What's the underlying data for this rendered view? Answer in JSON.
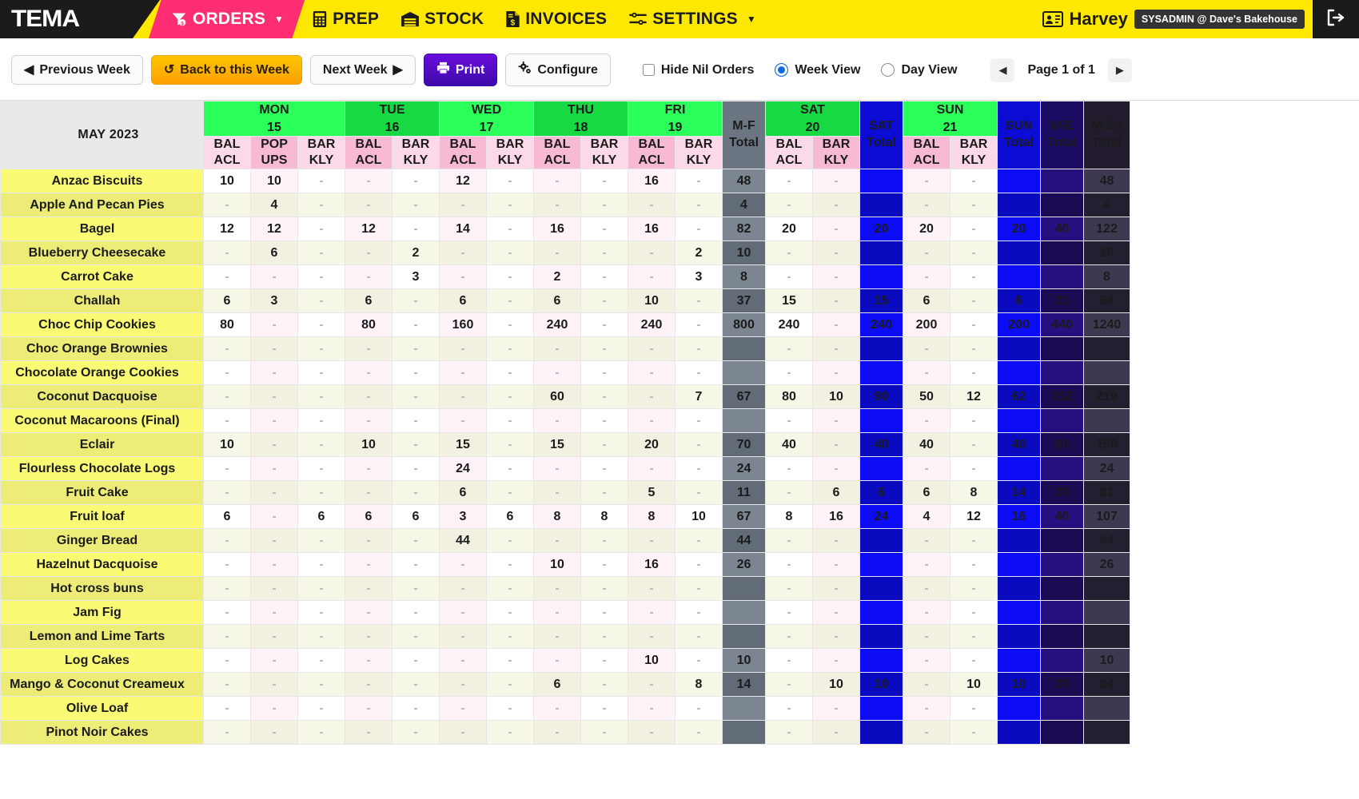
{
  "nav": {
    "logo": "TEMA",
    "items": [
      {
        "label": "ORDERS",
        "icon": "funnel-dollar-icon",
        "active": true,
        "caret": true
      },
      {
        "label": "PREP",
        "icon": "calculator-icon",
        "active": false,
        "caret": false
      },
      {
        "label": "STOCK",
        "icon": "warehouse-icon",
        "active": false,
        "caret": false
      },
      {
        "label": "INVOICES",
        "icon": "invoice-dollar-icon",
        "active": false,
        "caret": false
      },
      {
        "label": "SETTINGS",
        "icon": "sliders-icon",
        "active": false,
        "caret": true
      }
    ],
    "user_name": "Harvey",
    "user_badge": "SYSADMIN @ Dave's Bakehouse",
    "logout_icon": "logout-icon"
  },
  "toolbar": {
    "previous_week": "Previous Week",
    "back_to_this_week": "Back to this Week",
    "next_week": "Next Week",
    "print": "Print",
    "configure": "Configure",
    "hide_nil_orders": "Hide Nil Orders",
    "hide_nil_checked": false,
    "week_view": "Week View",
    "day_view": "Day View",
    "view_mode": "Week View",
    "page_label": "Page 1 of 1",
    "accent_print": "#4d0bc8",
    "accent_back": "#ffa000",
    "accent_radio": "#0a6ae1"
  },
  "grid": {
    "month_label": "MAY 2023",
    "days": [
      {
        "name": "MON",
        "num": "15",
        "shade": "a",
        "cols": [
          {
            "l1": "BAL",
            "l2": "ACL",
            "shade": "a"
          },
          {
            "l1": "POP",
            "l2": "UPS",
            "shade": "b"
          },
          {
            "l1": "BAR",
            "l2": "KLY",
            "shade": "a"
          }
        ]
      },
      {
        "name": "TUE",
        "num": "16",
        "shade": "b",
        "cols": [
          {
            "l1": "BAL",
            "l2": "ACL",
            "shade": "b"
          },
          {
            "l1": "BAR",
            "l2": "KLY",
            "shade": "a"
          }
        ]
      },
      {
        "name": "WED",
        "num": "17",
        "shade": "a",
        "cols": [
          {
            "l1": "BAL",
            "l2": "ACL",
            "shade": "b"
          },
          {
            "l1": "BAR",
            "l2": "KLY",
            "shade": "a"
          }
        ]
      },
      {
        "name": "THU",
        "num": "18",
        "shade": "b",
        "cols": [
          {
            "l1": "BAL",
            "l2": "ACL",
            "shade": "b"
          },
          {
            "l1": "BAR",
            "l2": "KLY",
            "shade": "a"
          }
        ]
      },
      {
        "name": "FRI",
        "num": "19",
        "shade": "a",
        "cols": [
          {
            "l1": "BAL",
            "l2": "ACL",
            "shade": "b"
          },
          {
            "l1": "BAR",
            "l2": "KLY",
            "shade": "a"
          }
        ]
      }
    ],
    "mf_total": {
      "l1": "M-F",
      "l2": "Total"
    },
    "sat": {
      "name": "SAT",
      "num": "20",
      "shade": "b",
      "cols": [
        {
          "l1": "BAL",
          "l2": "ACL",
          "shade": "a"
        },
        {
          "l1": "BAR",
          "l2": "KLY",
          "shade": "b"
        }
      ]
    },
    "sat_total": {
      "l1": "SAT",
      "l2": "Total"
    },
    "sun": {
      "name": "SUN",
      "num": "21",
      "shade": "a",
      "cols": [
        {
          "l1": "BAL",
          "l2": "ACL",
          "shade": "b"
        },
        {
          "l1": "BAR",
          "l2": "KLY",
          "shade": "a"
        }
      ]
    },
    "sun_total": {
      "l1": "SUN",
      "l2": "Total"
    },
    "we_total": {
      "l1": "W/E",
      "l2": "Total"
    },
    "msn_total": {
      "l1": "M-Sn",
      "l2": "Total"
    },
    "nil_symbol": "-",
    "rows": [
      {
        "name": "Anzac Biscuits",
        "v": [
          "10",
          "10",
          "-",
          "-",
          "-",
          "12",
          "-",
          "-",
          "-",
          "16",
          "-"
        ],
        "mf": "48",
        "sat": [
          "-",
          "-"
        ],
        "sattot": "",
        "sun": [
          "-",
          "-"
        ],
        "suntot": "",
        "we": "",
        "msn": "48"
      },
      {
        "name": "Apple And Pecan Pies",
        "v": [
          "-",
          "4",
          "-",
          "-",
          "-",
          "-",
          "-",
          "-",
          "-",
          "-",
          "-"
        ],
        "mf": "4",
        "sat": [
          "-",
          "-"
        ],
        "sattot": "",
        "sun": [
          "-",
          "-"
        ],
        "suntot": "",
        "we": "",
        "msn": "4"
      },
      {
        "name": "Bagel",
        "v": [
          "12",
          "12",
          "-",
          "12",
          "-",
          "14",
          "-",
          "16",
          "-",
          "16",
          "-"
        ],
        "mf": "82",
        "sat": [
          "20",
          "-"
        ],
        "sattot": "20",
        "sun": [
          "20",
          "-"
        ],
        "suntot": "20",
        "we": "40",
        "msn": "122"
      },
      {
        "name": "Blueberry Cheesecake",
        "v": [
          "-",
          "6",
          "-",
          "-",
          "2",
          "-",
          "-",
          "-",
          "-",
          "-",
          "2"
        ],
        "mf": "10",
        "sat": [
          "-",
          "-"
        ],
        "sattot": "",
        "sun": [
          "-",
          "-"
        ],
        "suntot": "",
        "we": "",
        "msn": "10"
      },
      {
        "name": "Carrot Cake",
        "v": [
          "-",
          "-",
          "-",
          "-",
          "3",
          "-",
          "-",
          "2",
          "-",
          "-",
          "3"
        ],
        "mf": "8",
        "sat": [
          "-",
          "-"
        ],
        "sattot": "",
        "sun": [
          "-",
          "-"
        ],
        "suntot": "",
        "we": "",
        "msn": "8"
      },
      {
        "name": "Challah",
        "v": [
          "6",
          "3",
          "-",
          "6",
          "-",
          "6",
          "-",
          "6",
          "-",
          "10",
          "-"
        ],
        "mf": "37",
        "sat": [
          "15",
          "-"
        ],
        "sattot": "15",
        "sun": [
          "6",
          "-"
        ],
        "suntot": "6",
        "we": "21",
        "msn": "58"
      },
      {
        "name": "Choc Chip Cookies",
        "v": [
          "80",
          "-",
          "-",
          "80",
          "-",
          "160",
          "-",
          "240",
          "-",
          "240",
          "-"
        ],
        "mf": "800",
        "sat": [
          "240",
          "-"
        ],
        "sattot": "240",
        "sun": [
          "200",
          "-"
        ],
        "suntot": "200",
        "we": "440",
        "msn": "1240"
      },
      {
        "name": "Choc Orange Brownies",
        "v": [
          "-",
          "-",
          "-",
          "-",
          "-",
          "-",
          "-",
          "-",
          "-",
          "-",
          "-"
        ],
        "mf": "",
        "sat": [
          "-",
          "-"
        ],
        "sattot": "",
        "sun": [
          "-",
          "-"
        ],
        "suntot": "",
        "we": "",
        "msn": ""
      },
      {
        "name": "Chocolate Orange Cookies",
        "v": [
          "-",
          "-",
          "-",
          "-",
          "-",
          "-",
          "-",
          "-",
          "-",
          "-",
          "-"
        ],
        "mf": "",
        "sat": [
          "-",
          "-"
        ],
        "sattot": "",
        "sun": [
          "-",
          "-"
        ],
        "suntot": "",
        "we": "",
        "msn": ""
      },
      {
        "name": "Coconut Dacquoise",
        "v": [
          "-",
          "-",
          "-",
          "-",
          "-",
          "-",
          "-",
          "60",
          "-",
          "-",
          "7"
        ],
        "mf": "67",
        "sat": [
          "80",
          "10"
        ],
        "sattot": "90",
        "sun": [
          "50",
          "12"
        ],
        "suntot": "62",
        "we": "152",
        "msn": "219"
      },
      {
        "name": "Coconut Macaroons (Final)",
        "v": [
          "-",
          "-",
          "-",
          "-",
          "-",
          "-",
          "-",
          "-",
          "-",
          "-",
          "-"
        ],
        "mf": "",
        "sat": [
          "-",
          "-"
        ],
        "sattot": "",
        "sun": [
          "-",
          "-"
        ],
        "suntot": "",
        "we": "",
        "msn": ""
      },
      {
        "name": "Eclair",
        "v": [
          "10",
          "-",
          "-",
          "10",
          "-",
          "15",
          "-",
          "15",
          "-",
          "20",
          "-"
        ],
        "mf": "70",
        "sat": [
          "40",
          "-"
        ],
        "sattot": "40",
        "sun": [
          "40",
          "-"
        ],
        "suntot": "40",
        "we": "80",
        "msn": "150"
      },
      {
        "name": "Flourless Chocolate Logs",
        "v": [
          "-",
          "-",
          "-",
          "-",
          "-",
          "24",
          "-",
          "-",
          "-",
          "-",
          "-"
        ],
        "mf": "24",
        "sat": [
          "-",
          "-"
        ],
        "sattot": "",
        "sun": [
          "-",
          "-"
        ],
        "suntot": "",
        "we": "",
        "msn": "24"
      },
      {
        "name": "Fruit Cake",
        "v": [
          "-",
          "-",
          "-",
          "-",
          "-",
          "6",
          "-",
          "-",
          "-",
          "5",
          "-"
        ],
        "mf": "11",
        "sat": [
          "-",
          "6"
        ],
        "sattot": "6",
        "sun": [
          "6",
          "8"
        ],
        "suntot": "14",
        "we": "20",
        "msn": "31"
      },
      {
        "name": "Fruit loaf",
        "v": [
          "6",
          "-",
          "6",
          "6",
          "6",
          "3",
          "6",
          "8",
          "8",
          "8",
          "10"
        ],
        "mf": "67",
        "sat": [
          "8",
          "16"
        ],
        "sattot": "24",
        "sun": [
          "4",
          "12"
        ],
        "suntot": "16",
        "we": "40",
        "msn": "107"
      },
      {
        "name": "Ginger Bread",
        "v": [
          "-",
          "-",
          "-",
          "-",
          "-",
          "44",
          "-",
          "-",
          "-",
          "-",
          "-"
        ],
        "mf": "44",
        "sat": [
          "-",
          "-"
        ],
        "sattot": "",
        "sun": [
          "-",
          "-"
        ],
        "suntot": "",
        "we": "",
        "msn": "44"
      },
      {
        "name": "Hazelnut Dacquoise",
        "v": [
          "-",
          "-",
          "-",
          "-",
          "-",
          "-",
          "-",
          "10",
          "-",
          "16",
          "-"
        ],
        "mf": "26",
        "sat": [
          "-",
          "-"
        ],
        "sattot": "",
        "sun": [
          "-",
          "-"
        ],
        "suntot": "",
        "we": "",
        "msn": "26"
      },
      {
        "name": "Hot cross buns",
        "v": [
          "-",
          "-",
          "-",
          "-",
          "-",
          "-",
          "-",
          "-",
          "-",
          "-",
          "-"
        ],
        "mf": "",
        "sat": [
          "-",
          "-"
        ],
        "sattot": "",
        "sun": [
          "-",
          "-"
        ],
        "suntot": "",
        "we": "",
        "msn": ""
      },
      {
        "name": "Jam Fig",
        "v": [
          "-",
          "-",
          "-",
          "-",
          "-",
          "-",
          "-",
          "-",
          "-",
          "-",
          "-"
        ],
        "mf": "",
        "sat": [
          "-",
          "-"
        ],
        "sattot": "",
        "sun": [
          "-",
          "-"
        ],
        "suntot": "",
        "we": "",
        "msn": ""
      },
      {
        "name": "Lemon and Lime Tarts",
        "v": [
          "-",
          "-",
          "-",
          "-",
          "-",
          "-",
          "-",
          "-",
          "-",
          "-",
          "-"
        ],
        "mf": "",
        "sat": [
          "-",
          "-"
        ],
        "sattot": "",
        "sun": [
          "-",
          "-"
        ],
        "suntot": "",
        "we": "",
        "msn": ""
      },
      {
        "name": "Log Cakes",
        "v": [
          "-",
          "-",
          "-",
          "-",
          "-",
          "-",
          "-",
          "-",
          "-",
          "10",
          "-"
        ],
        "mf": "10",
        "sat": [
          "-",
          "-"
        ],
        "sattot": "",
        "sun": [
          "-",
          "-"
        ],
        "suntot": "",
        "we": "",
        "msn": "10"
      },
      {
        "name": "Mango & Coconut Creameux",
        "v": [
          "-",
          "-",
          "-",
          "-",
          "-",
          "-",
          "-",
          "6",
          "-",
          "-",
          "8"
        ],
        "mf": "14",
        "sat": [
          "-",
          "10"
        ],
        "sattot": "10",
        "sun": [
          "-",
          "10"
        ],
        "suntot": "10",
        "we": "20",
        "msn": "34"
      },
      {
        "name": "Olive Loaf",
        "v": [
          "-",
          "-",
          "-",
          "-",
          "-",
          "-",
          "-",
          "-",
          "-",
          "-",
          "-"
        ],
        "mf": "",
        "sat": [
          "-",
          "-"
        ],
        "sattot": "",
        "sun": [
          "-",
          "-"
        ],
        "suntot": "",
        "we": "",
        "msn": ""
      },
      {
        "name": "Pinot Noir Cakes",
        "v": [
          "-",
          "-",
          "-",
          "-",
          "-",
          "-",
          "-",
          "-",
          "-",
          "-",
          "-"
        ],
        "mf": "",
        "sat": [
          "-",
          "-"
        ],
        "sattot": "",
        "sun": [
          "-",
          "-"
        ],
        "suntot": "",
        "we": "",
        "msn": ""
      }
    ]
  }
}
